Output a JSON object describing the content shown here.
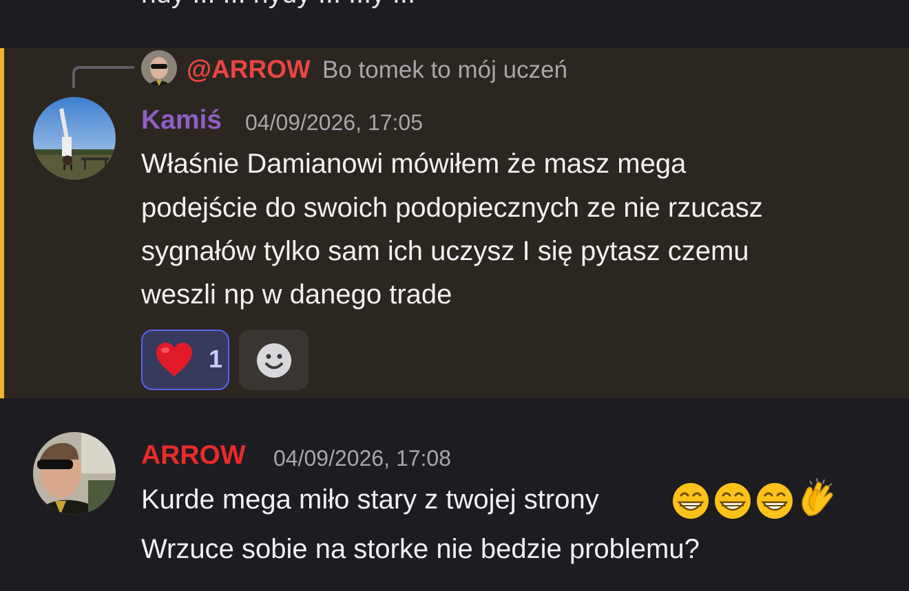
{
  "previous_message": {
    "text": "ndy ... ... nydy ... ...y ..."
  },
  "reply_preview": {
    "mention": "@ARROW",
    "text": "Bo tomek to mój uczeń"
  },
  "message_1": {
    "username": "Kamiś",
    "username_color": "#8e5ec4",
    "timestamp": "04/09/2026, 17:05",
    "lines": [
      "Właśnie Damianowi mówiłem że masz mega",
      "podejście do swoich podopiecznych ze nie rzucasz",
      "sygnałów tylko sam ich uczysz I się pytasz czemu",
      "weszli np w danego trade"
    ],
    "reaction": {
      "emoji": "heart-icon",
      "count": "1"
    }
  },
  "message_2": {
    "username": "ARROW",
    "username_color": "#ea2b2b",
    "timestamp": "04/09/2026, 17:08",
    "lines": [
      "Kurde mega miło stary z twojej strony",
      "Wrzuce sobie na storke nie bedzie problemu?"
    ],
    "emojis": [
      "grinning-face-icon",
      "grinning-face-icon",
      "grinning-face-icon",
      "clapping-hands-icon"
    ]
  },
  "colors": {
    "background": "#1c1c21",
    "highlight_background": "#2c2620",
    "highlight_bar": "#f0b232",
    "reaction_border": "#5865f2"
  }
}
